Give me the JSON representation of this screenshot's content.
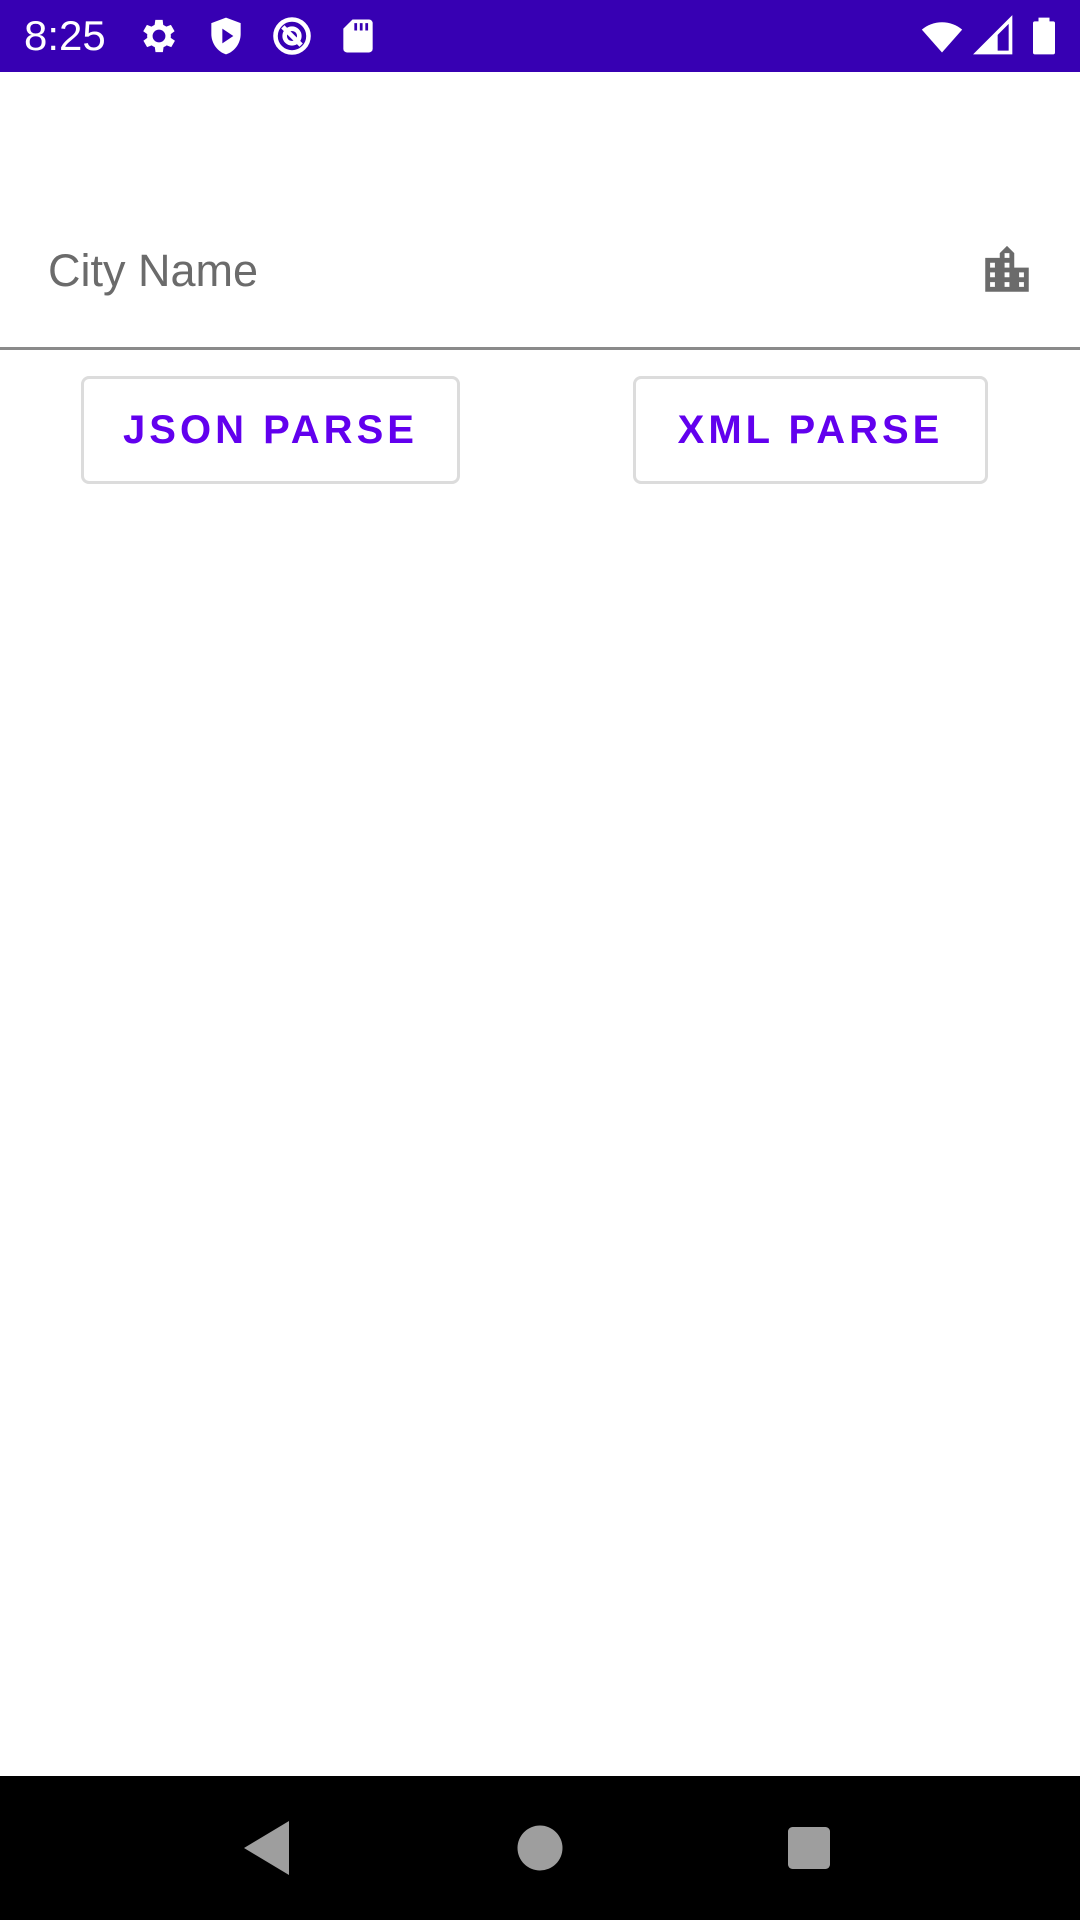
{
  "status_bar": {
    "time": "8:25",
    "background": "#3700b3",
    "left_icons": [
      "gear-icon",
      "shield-play-icon",
      "at-sign-icon",
      "sd-card-icon"
    ],
    "right_icons": [
      "wifi-icon",
      "cell-signal-icon",
      "battery-icon"
    ]
  },
  "form": {
    "city_field": {
      "placeholder": "City Name",
      "value": "",
      "icon": "city-buildings-icon"
    },
    "json_button_label": "JSON PARSE",
    "xml_button_label": "XML PARSE",
    "accent_color": "#6200ee"
  },
  "nav_bar": {
    "buttons": [
      "back-icon",
      "home-icon",
      "recents-icon"
    ]
  }
}
